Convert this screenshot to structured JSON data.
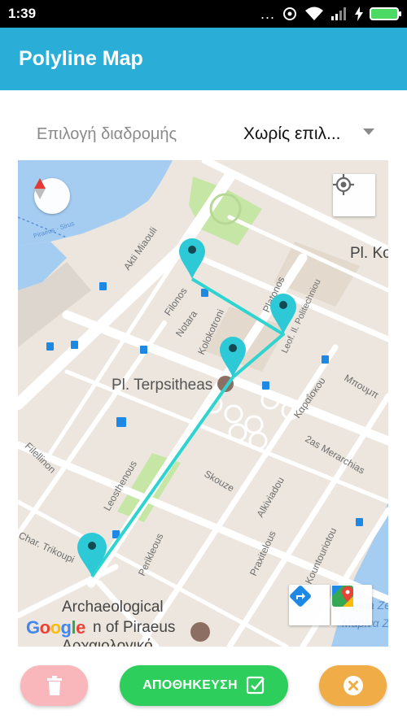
{
  "status_bar": {
    "time": "1:39",
    "indicators": "..."
  },
  "app_bar": {
    "title": "Polyline Map"
  },
  "route_selector": {
    "label": "Επιλογή διαδρομής",
    "value": "Χωρίς επιλ..."
  },
  "map": {
    "labels": {
      "area_northeast": "Pl. Ko",
      "akti_miaouli": "Akti Miaouli",
      "filonos": "Filonos",
      "notara": "Notara",
      "kolokotroni": "Kolokotroni",
      "platonos": "Platonos",
      "leoforos_politechniou": "Leof. Il. Politechniou",
      "pl_terpsitheas": "Pl. Terpsitheas",
      "karaiskou": "Καραΐσκου",
      "bournpoulinas": "Μπουμπ",
      "merarchias": "2as Merarchias",
      "filellinon": "Filellinon",
      "leosthenous": "Leosthenous",
      "skouze": "Skouze",
      "alkiviadou": "Alkiviadou",
      "char_trikoupi": "Char. Trikoupi",
      "perikleous": "Perikleous",
      "praxitelous": "Praxitelous",
      "kountouriotou": "Kountouriotou",
      "museum_line1": "Archaeological",
      "museum_line2": "n of Piraeus",
      "museum_line3": "Αρχαιολογικό",
      "marina_line1": "Marina Zeas",
      "marina_line2": "Μαρίνα Ζέας",
      "piraeus_ferry": "Piraeus - Sirus"
    },
    "google_logo": [
      "G",
      "o",
      "o",
      "g",
      "l",
      "e"
    ],
    "markers": [
      {
        "name": "marker-1"
      },
      {
        "name": "marker-2"
      },
      {
        "name": "marker-3"
      },
      {
        "name": "marker-4"
      }
    ],
    "colors": {
      "polyline": "#2fd4d0",
      "marker": "#2ec9d6",
      "water": "#a5cdf2",
      "park": "#c6e6a6",
      "road": "#ffffff",
      "land": "#ece6df"
    }
  },
  "actions": {
    "delete": {
      "icon": "trash-icon"
    },
    "save": {
      "label": "ΑΠΟΘΗΚΕΥΣΗ",
      "icon": "check-square-icon"
    },
    "cancel": {
      "icon": "close-circle-icon"
    }
  }
}
